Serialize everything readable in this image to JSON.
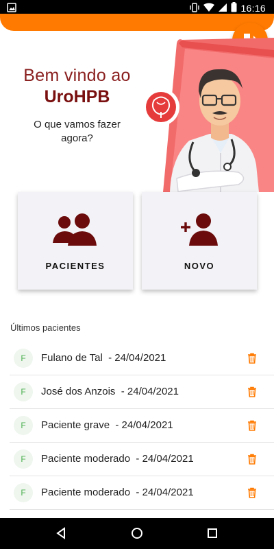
{
  "status_bar": {
    "time": "16:16",
    "left_icon": "image-icon",
    "right_icons": [
      "vibrate-icon",
      "wifi-icon",
      "signal-icon",
      "battery-icon"
    ]
  },
  "header": {
    "accent_color": "#ff7a00",
    "logout_icon": "logout-icon"
  },
  "welcome": {
    "greeting": "Bem vindo ao",
    "app_name": "UroHPB",
    "question": "O que vamos fazer agora?"
  },
  "actions": [
    {
      "label": "PACIENTES",
      "icon": "users-icon"
    },
    {
      "label": "NOVO",
      "icon": "add-user-icon"
    }
  ],
  "recent": {
    "title": "Últimos pacientes",
    "patients": [
      {
        "initial": "F",
        "name": "Fulano de Tal  - 24/04/2021"
      },
      {
        "initial": "F",
        "name": "José dos Anzois  - 24/04/2021"
      },
      {
        "initial": "F",
        "name": "Paciente grave  - 24/04/2021"
      },
      {
        "initial": "F",
        "name": "Paciente moderado  - 24/04/2021"
      },
      {
        "initial": "F",
        "name": "Paciente moderado  - 24/04/2021"
      }
    ]
  },
  "nav": {
    "buttons": [
      "back-icon",
      "home-icon",
      "recents-icon"
    ]
  }
}
